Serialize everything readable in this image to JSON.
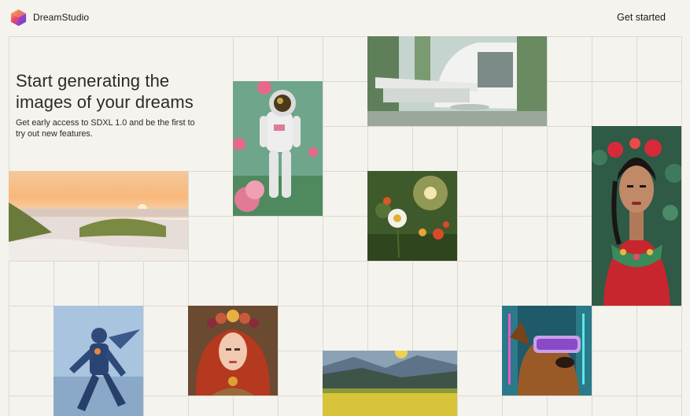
{
  "header": {
    "logo_icon": "hexagon-gradient-logo",
    "brand_name": "DreamStudio",
    "cta_label": "Get started"
  },
  "hero": {
    "headline": "Start generating the images of your dreams",
    "subtext": "Get early access to SDXL 1.0 and be the first to try out new features."
  },
  "colors": {
    "background": "#f5f3ee",
    "grid_line": "#dcd9d2",
    "text": "#2a2a2a"
  },
  "gallery": [
    {
      "name": "astronaut-roses"
    },
    {
      "name": "modern-house"
    },
    {
      "name": "woman-flower-crown"
    },
    {
      "name": "beach-sunset"
    },
    {
      "name": "daisy-meadow"
    },
    {
      "name": "armored-robot"
    },
    {
      "name": "redhead-crown"
    },
    {
      "name": "mountain-valley"
    },
    {
      "name": "dog-vr-headset"
    }
  ]
}
